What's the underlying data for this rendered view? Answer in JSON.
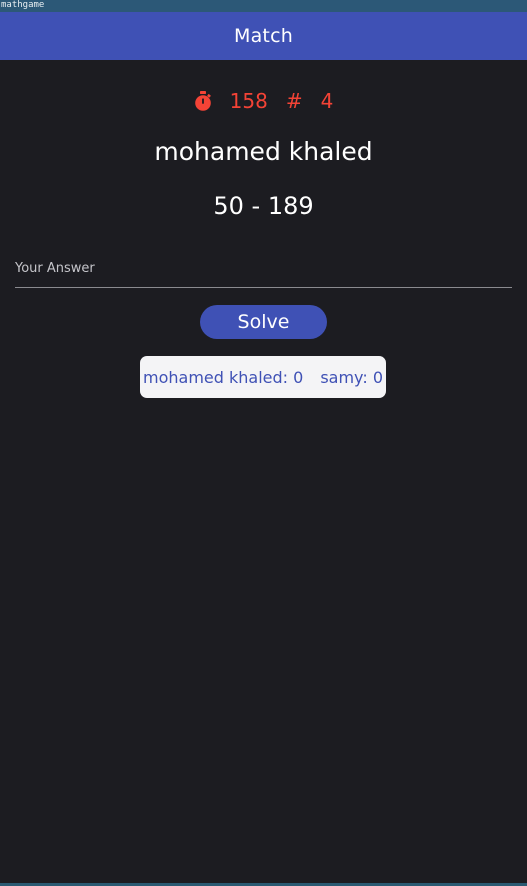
{
  "window": {
    "title": "mathgame"
  },
  "appbar": {
    "title": "Match"
  },
  "status": {
    "timer_icon": "stopwatch-icon",
    "timer_value": "158",
    "round_symbol": "#",
    "round_value": "4",
    "accent_color": "#f44336"
  },
  "player": {
    "name": "mohamed khaled"
  },
  "question": {
    "text": "50 - 189"
  },
  "answer": {
    "placeholder": "Your Answer",
    "value": ""
  },
  "actions": {
    "solve_label": "Solve"
  },
  "scores": [
    {
      "label": "mohamed khaled: 0"
    },
    {
      "label": "samy: 0"
    }
  ],
  "colors": {
    "primary": "#3f51b5",
    "background": "#1c1c21",
    "score_chip": "#f4f4f6"
  }
}
